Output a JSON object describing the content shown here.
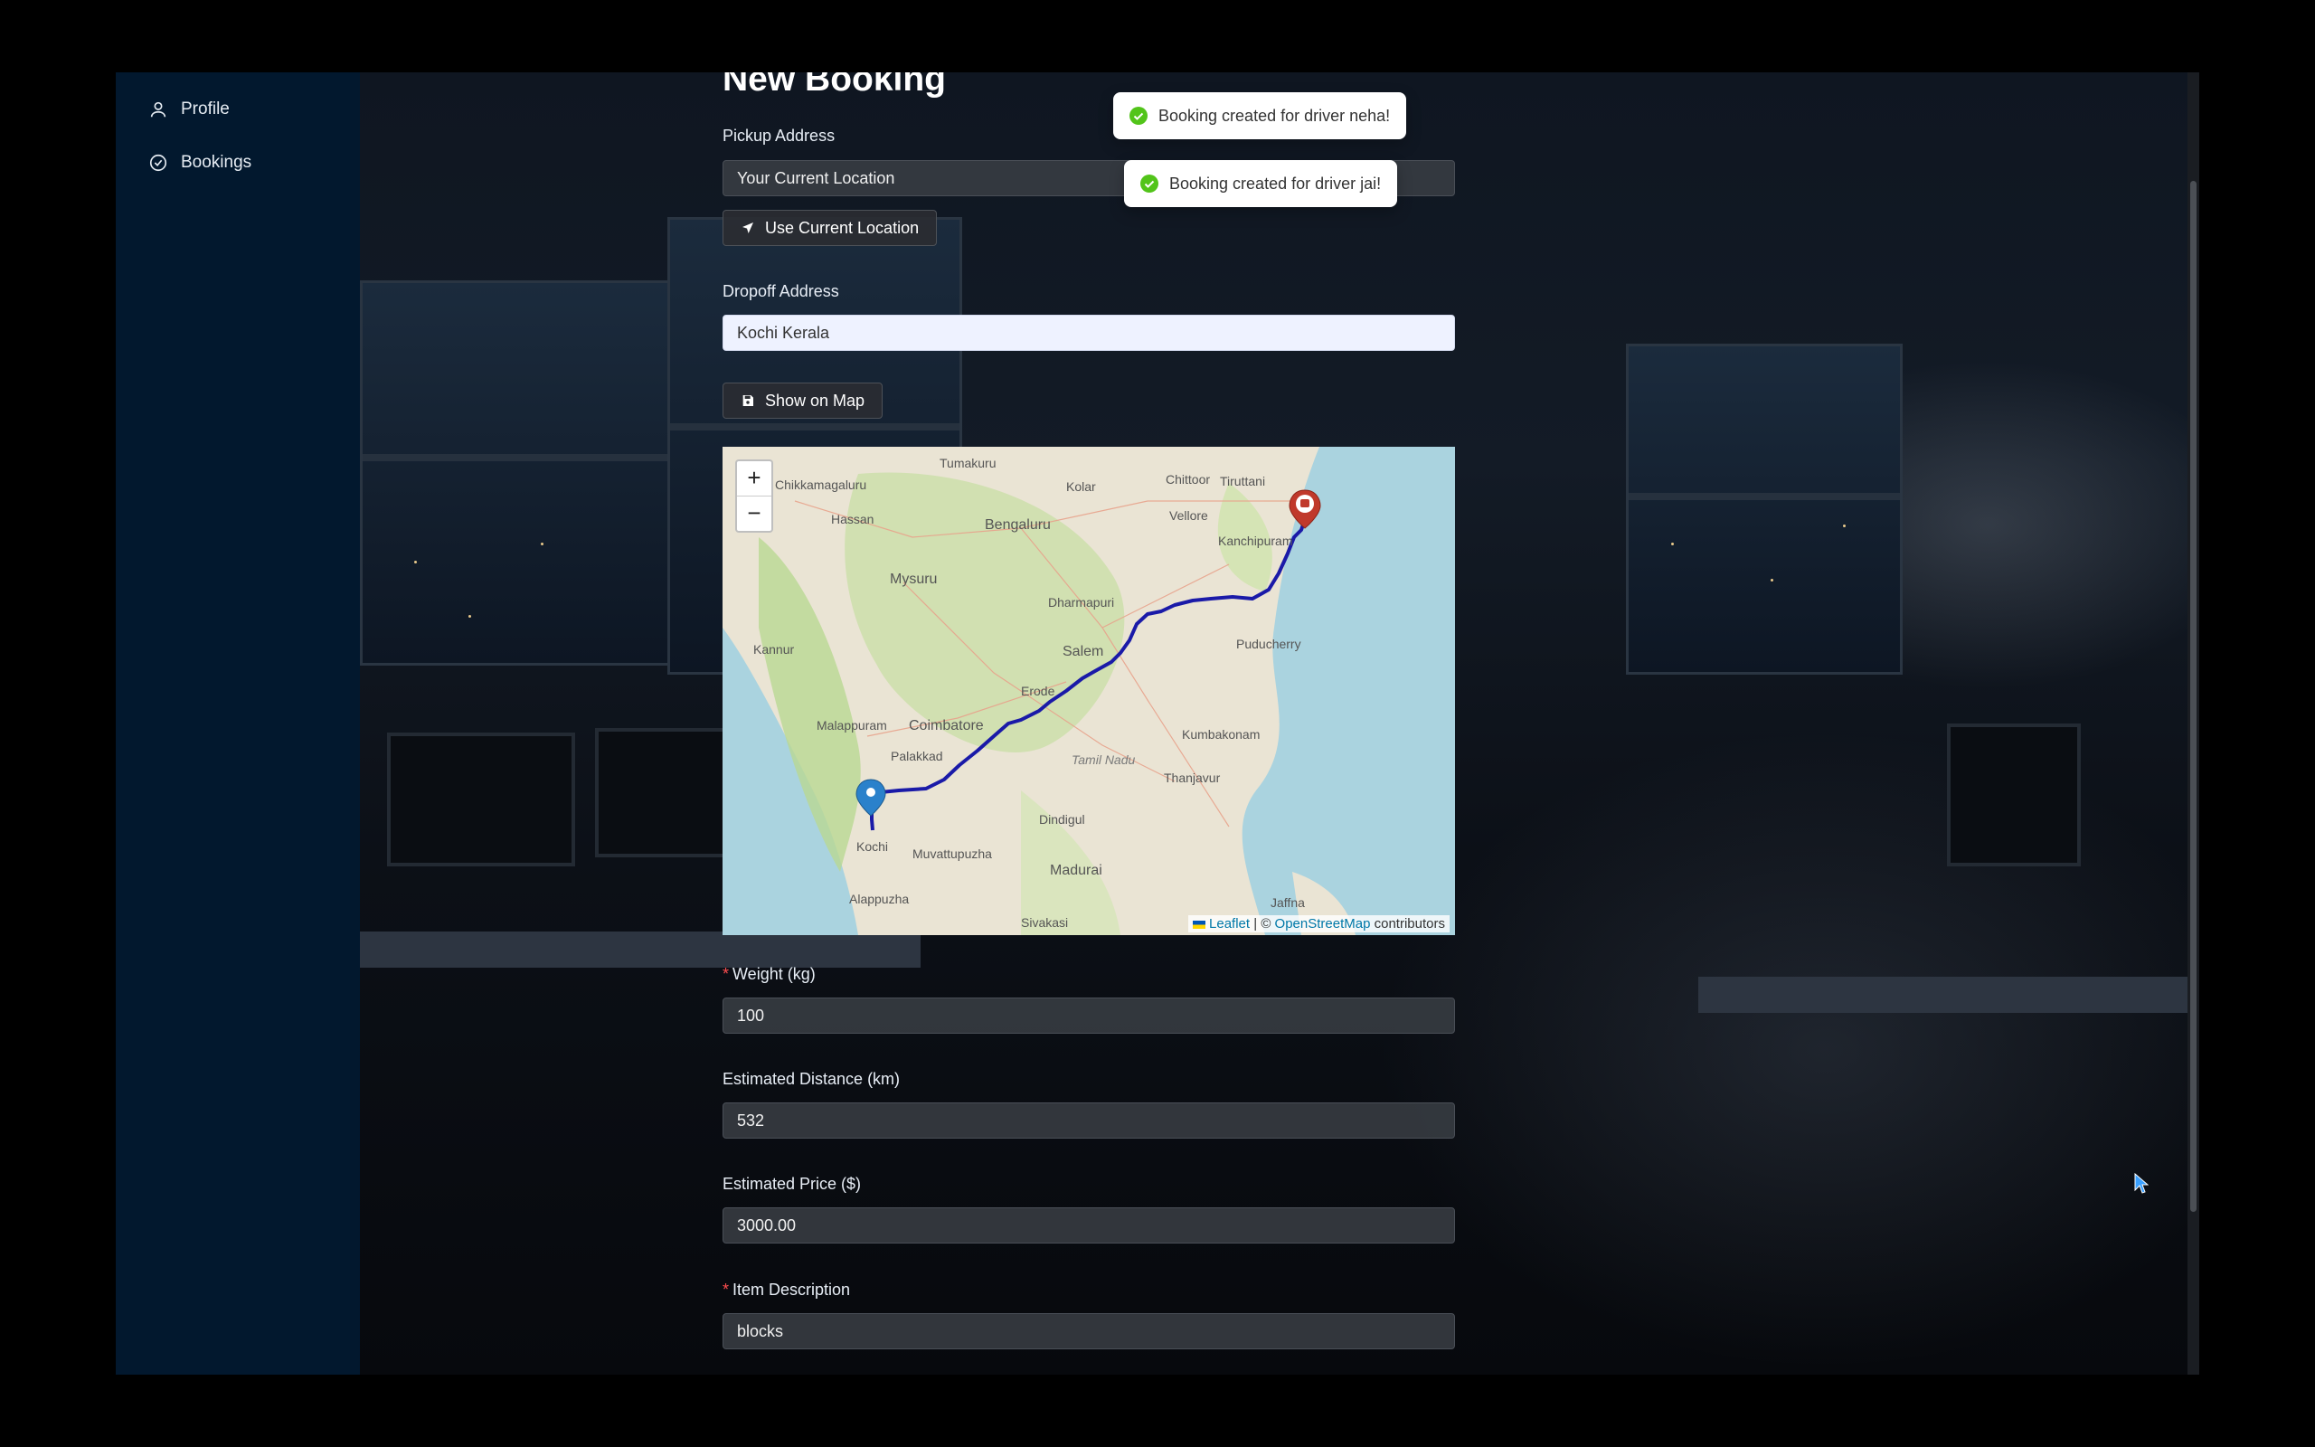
{
  "sidebar": {
    "items": [
      {
        "label": "Profile",
        "icon": "user-icon"
      },
      {
        "label": "Bookings",
        "icon": "check-circle-icon"
      }
    ]
  },
  "form": {
    "title": "New Booking",
    "pickup_label": "Pickup Address",
    "pickup_value": "Your Current Location",
    "use_location_label": "Use Current Location",
    "dropoff_label": "Dropoff Address",
    "dropoff_value": "Kochi Kerala",
    "show_map_label": "Show on Map",
    "weight_label": "Weight (kg)",
    "weight_value": "100",
    "distance_label": "Estimated Distance (km)",
    "distance_value": "532",
    "price_label": "Estimated Price ($)",
    "price_value": "3000.00",
    "description_label": "Item Description",
    "description_value": "blocks"
  },
  "map": {
    "zoom_in": "+",
    "zoom_out": "−",
    "attribution_leaflet": "Leaflet",
    "attribution_sep": "| ©",
    "attribution_osm": "OpenStreetMap",
    "attribution_tail": "contributors",
    "route_color": "#1a1aa8",
    "places": [
      "Tumakuru",
      "Kolar",
      "Chittoor",
      "Tiruttani",
      "Chikkamagaluru",
      "Hassan",
      "Bengaluru",
      "Vellore",
      "Mysuru",
      "Kanchipuram",
      "Dharmapuri",
      "Kannur",
      "Salem",
      "Puducherry",
      "Erode",
      "Malappuram",
      "Coimbatore",
      "Kumbakonam",
      "Palakkad",
      "Tamil Nadu",
      "Thanjavur",
      "Kochi",
      "Dindigul",
      "Muvattupuzha",
      "Madurai",
      "Alappuzha",
      "Jaffna",
      "Sivakasi"
    ]
  },
  "toasts": [
    {
      "text": "Booking created for driver neha!"
    },
    {
      "text": "Booking created for driver jai!"
    }
  ],
  "colors": {
    "sidebar": "#02182e",
    "success": "#52c41a",
    "required": "#ff4d4f"
  }
}
